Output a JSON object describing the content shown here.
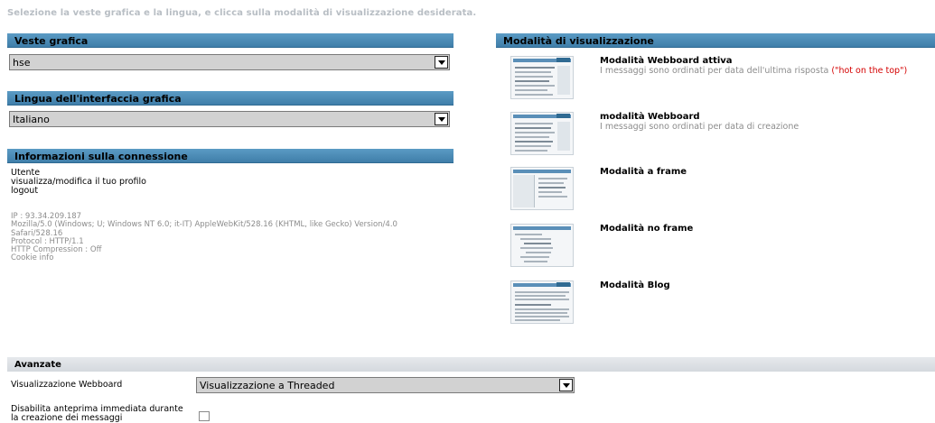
{
  "intro_text": "Selezione la veste grafica e la lingua, e clicca sulla modalità di visualizzazione desiderata.",
  "theme": {
    "title": "Veste grafica",
    "selected": "hse"
  },
  "language": {
    "title": "Lingua dell'interfaccia grafica",
    "selected": "Italiano"
  },
  "connection": {
    "title": "Informazioni sulla connessione",
    "links": [
      "Utente",
      "visualizza/modifica il tuo profilo",
      "logout"
    ],
    "info": [
      "IP : 93.34.209.187",
      "Mozilla/5.0 (Windows; U; Windows NT 6.0; it-IT) AppleWebKit/528.16 (KHTML, like Gecko) Version/4.0",
      "Safari/528.16",
      "Protocol : HTTP/1.1",
      "HTTP Compression : Off",
      "Cookie info"
    ]
  },
  "display_modes": {
    "title": "Modalità di visualizzazione",
    "items": [
      {
        "title": "Modalità Webboard attiva",
        "description": "I messaggi sono ordinati per data dell'ultima risposta ",
        "highlight": "(\"hot on the top\")"
      },
      {
        "title": "modalità Webboard",
        "description": "I messaggi sono ordinati per data di creazione",
        "highlight": ""
      },
      {
        "title": "Modalità a frame",
        "description": "",
        "highlight": ""
      },
      {
        "title": "Modalità no frame",
        "description": "",
        "highlight": ""
      },
      {
        "title": "Modalità Blog",
        "description": "",
        "highlight": ""
      }
    ]
  },
  "advanced": {
    "title": "Avanzate",
    "webboard_label": "Visualizzazione Webboard",
    "webboard_selected": "Visualizzazione a Threaded",
    "preview_label_line1": "Disabilita anteprima immediata durante",
    "preview_label_line2": "la creazione dei messaggi"
  },
  "colors": {
    "section_header": "#4a8ab5",
    "hot_text": "#d40000",
    "muted_text": "#8c8c8c"
  }
}
